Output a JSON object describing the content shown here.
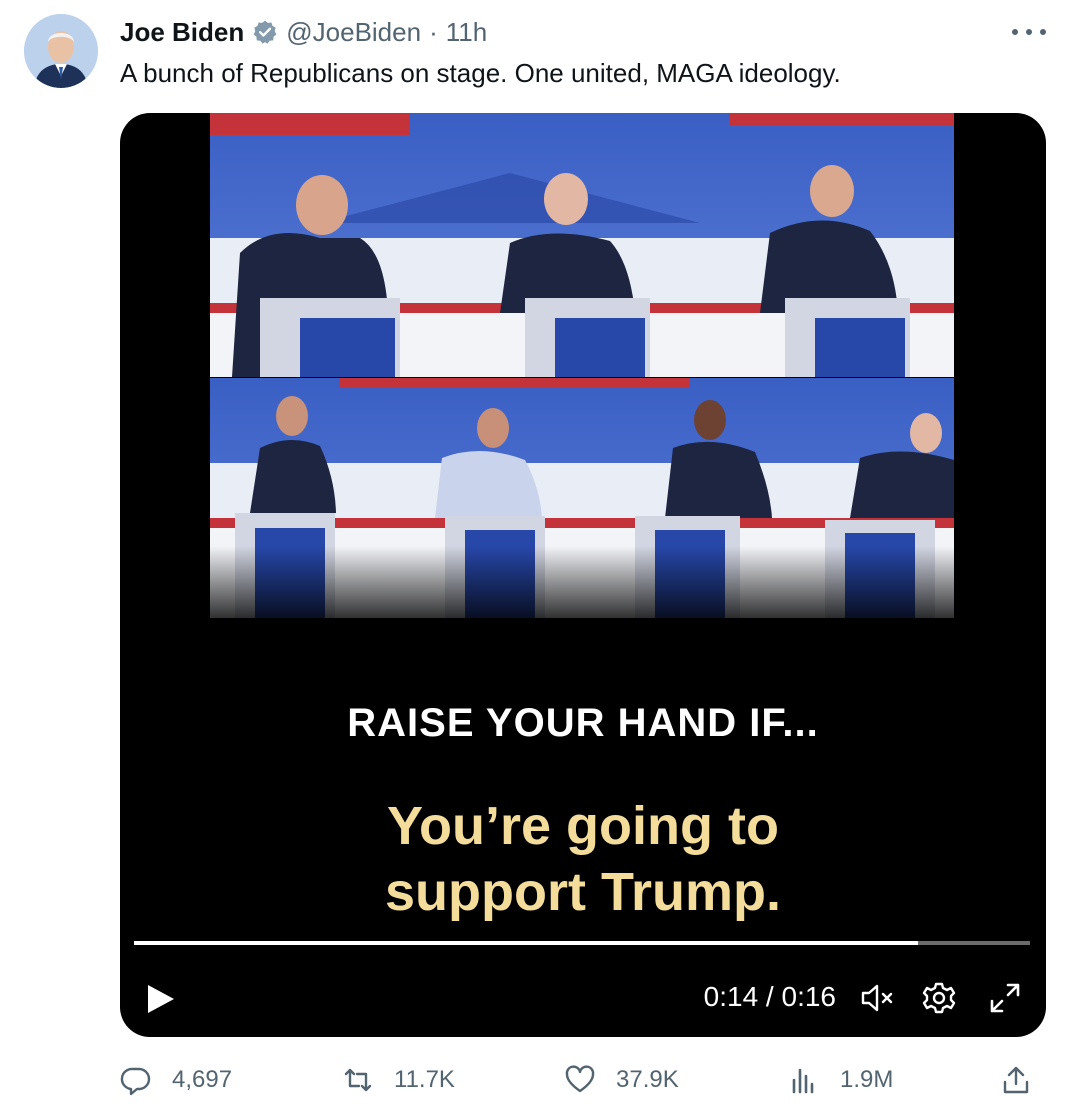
{
  "author": {
    "name": "Joe Biden",
    "handle": "@JoeBiden",
    "separator": "·",
    "time_ago": "11h",
    "verified": true,
    "avatar_icon": "profile-photo"
  },
  "tweet": {
    "text": "A bunch of Republicans on stage. One united, MAGA ideology."
  },
  "video": {
    "caption_line1": "RAISE YOUR HAND IF...",
    "caption_line2": "You’re going to",
    "caption_line3": "support Trump.",
    "current_time": "0:14",
    "duration": "0:16",
    "time_display": "0:14 / 0:16",
    "progress_fraction": 0.875,
    "muted": true,
    "caption_color": "#f4dc9a"
  },
  "actions": {
    "replies": "4,697",
    "reposts": "11.7K",
    "likes": "37.9K",
    "views": "1.9M"
  },
  "colors": {
    "text_primary": "#0f1419",
    "text_secondary": "#536471",
    "verified_badge": "#829aab"
  }
}
